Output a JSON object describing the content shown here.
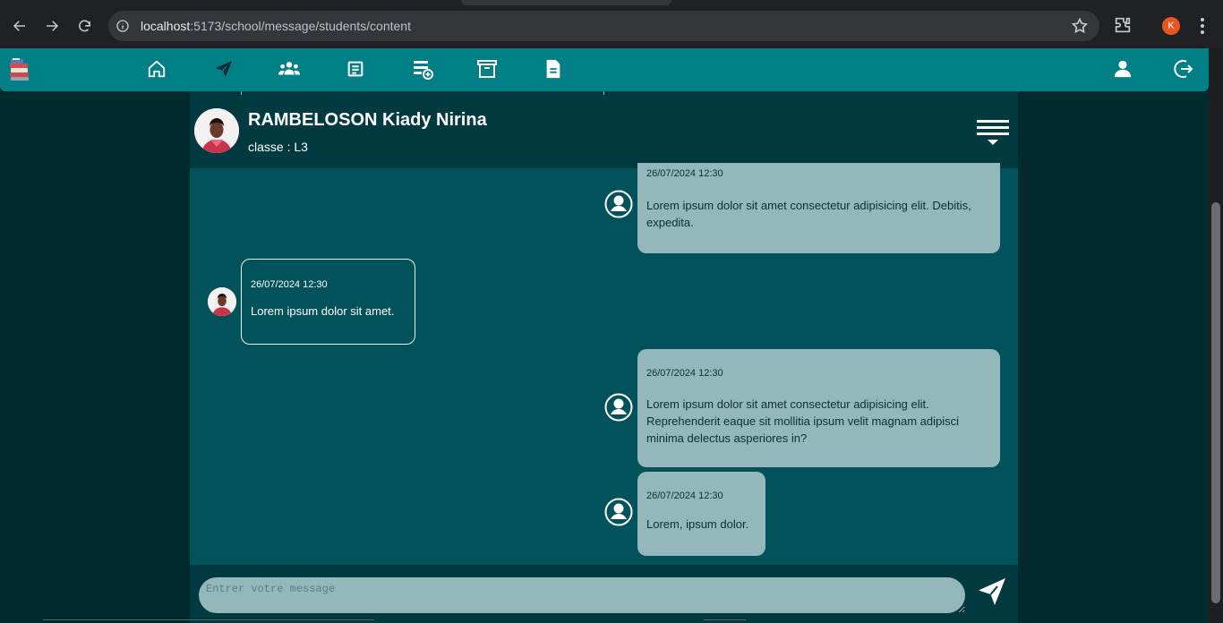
{
  "browser": {
    "url_host": "localhost",
    "url_path": ":5173/school/message/students/content",
    "profile_initial": "K"
  },
  "app_nav": {
    "icons": [
      "home-icon",
      "send-icon",
      "users-icon",
      "list-icon",
      "add-list-icon",
      "archive-icon",
      "document-icon"
    ],
    "right_icons": [
      "profile-icon",
      "logout-icon"
    ]
  },
  "chat": {
    "contact_name": "RAMBELOSON Kiady Nirina",
    "contact_class": "classe : L3",
    "messages": [
      {
        "direction": "sent",
        "date": "26/07/2024 12:30",
        "text": "Lorem ipsum dolor sit amet consectetur adipisicing elit. Debitis, expedita."
      },
      {
        "direction": "received",
        "date": "26/07/2024 12:30",
        "text": "Lorem ipsum dolor sit amet."
      },
      {
        "direction": "sent",
        "date": "26/07/2024 12:30",
        "text": "Lorem ipsum dolor sit amet consectetur adipisicing elit. Reprehenderit eaque sit mollitia ipsum velit magnam adipisci minima delectus asperiores in?"
      },
      {
        "direction": "sent",
        "date": "26/07/2024 12:30",
        "text": "Lorem, ipsum dolor."
      }
    ],
    "composer_placeholder": "Entrer votre message"
  },
  "colors": {
    "nav_bg": "#007f87",
    "chat_bg": "#02525b",
    "header_bg": "#003a41",
    "sent_bubble": "#93b7ba"
  }
}
